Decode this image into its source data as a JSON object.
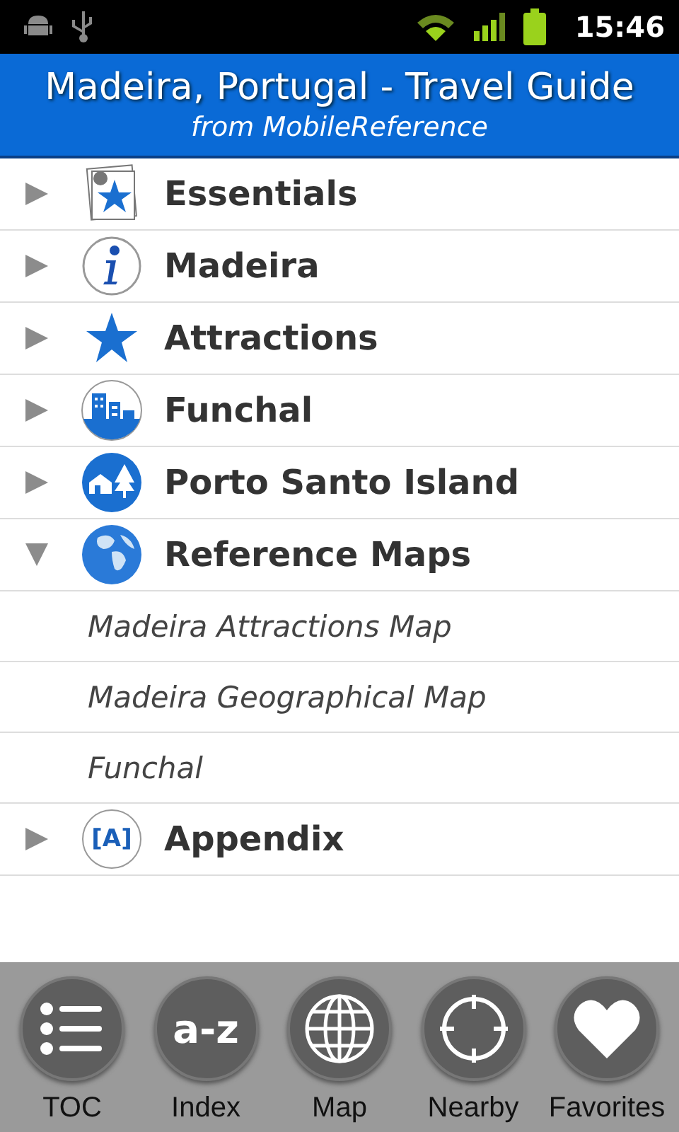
{
  "status_bar": {
    "time": "15:46"
  },
  "header": {
    "title": "Madeira, Portugal - Travel Guide",
    "subtitle": "from MobileReference"
  },
  "sections": [
    {
      "label": "Essentials",
      "expanded": false
    },
    {
      "label": "Madeira",
      "expanded": false
    },
    {
      "label": "Attractions",
      "expanded": false
    },
    {
      "label": "Funchal",
      "expanded": false
    },
    {
      "label": "Porto Santo Island",
      "expanded": false
    },
    {
      "label": "Reference Maps",
      "expanded": true,
      "children": [
        {
          "label": "Madeira Attractions Map"
        },
        {
          "label": "Madeira Geographical Map"
        },
        {
          "label": "Funchal"
        }
      ]
    },
    {
      "label": "Appendix",
      "expanded": false,
      "icon_text": "[A]"
    }
  ],
  "toolbar": [
    {
      "label": "TOC"
    },
    {
      "label": "Index",
      "icon_text": "a-z"
    },
    {
      "label": "Map"
    },
    {
      "label": "Nearby"
    },
    {
      "label": "Favorites"
    }
  ]
}
